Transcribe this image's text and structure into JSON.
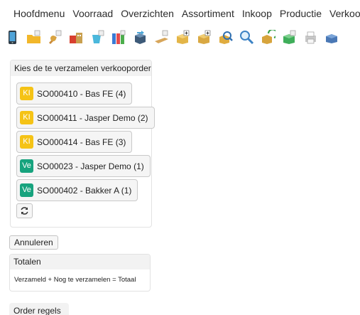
{
  "menu": {
    "items": [
      "Hoofdmenu",
      "Voorraad",
      "Overzichten",
      "Assortiment",
      "Inkoop",
      "Productie",
      "Verkoop"
    ]
  },
  "toolbar": {
    "icons": [
      "phone-icon",
      "folder-note-icon",
      "tools-note-icon",
      "package-building-icon",
      "bucket-note-icon",
      "binders-note-icon",
      "box-arrow-icon",
      "plank-note-icon",
      "box-plus-icon",
      "box-plus-two-icon",
      "magnifier-box-icon",
      "search-glass-icon",
      "refresh-box-icon",
      "box-note-icon",
      "printer-box-icon",
      "box-pallet-icon"
    ]
  },
  "choose_panel": {
    "title": "Kies de te verzamelen verkooporder",
    "orders": [
      {
        "badge": "KI",
        "badge_color": "#f5c316",
        "label": "SO000410 - Bas FE (4)"
      },
      {
        "badge": "KI",
        "badge_color": "#f5c316",
        "label": "SO000411 - Jasper Demo (2)"
      },
      {
        "badge": "KI",
        "badge_color": "#f5c316",
        "label": "SO000414 - Bas FE (3)"
      },
      {
        "badge": "Ve",
        "badge_color": "#17a37e",
        "label": "SO00023 - Jasper Demo (1)"
      },
      {
        "badge": "Ve",
        "badge_color": "#17a37e",
        "label": "SO000402 - Bakker A (1)"
      }
    ]
  },
  "cancel_label": "Annuleren",
  "totals": {
    "title": "Totalen",
    "formula": "Verzameld + Nog te verzamelen = Totaal"
  },
  "order_lines_title": "Order regels"
}
